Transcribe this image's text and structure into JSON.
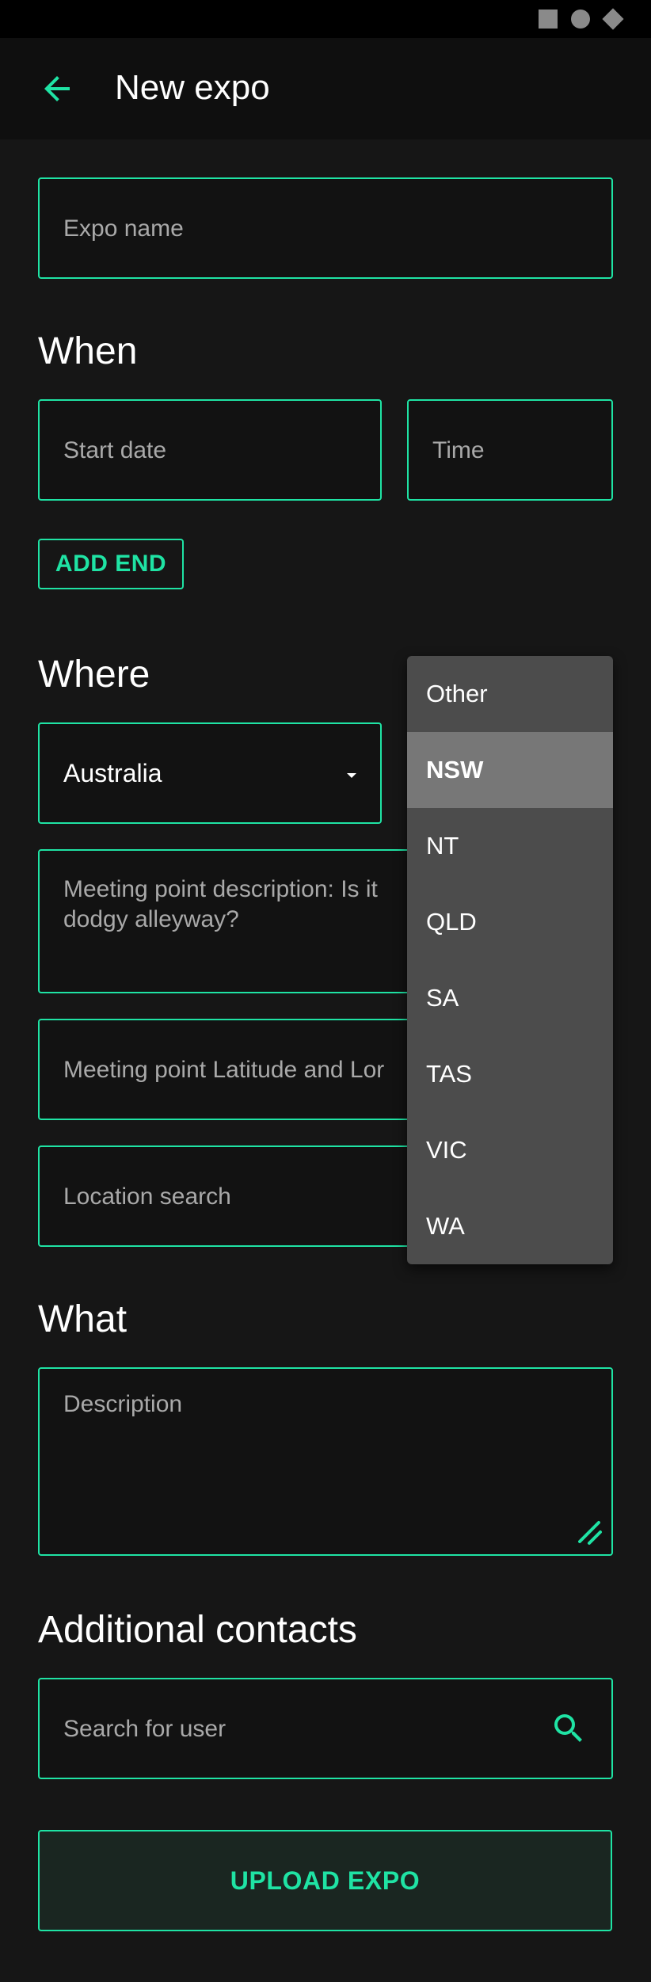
{
  "app": {
    "title": "New expo"
  },
  "form": {
    "expo_name_placeholder": "Expo name",
    "when_title": "When",
    "start_date_placeholder": "Start date",
    "time_placeholder": "Time",
    "add_end_label": "ADD END",
    "where_title": "Where",
    "country_value": "Australia",
    "meeting_point_description_placeholder_line1": "Meeting point description: Is it",
    "meeting_point_description_placeholder_line2": "dodgy alleyway?",
    "meeting_point_latlng_placeholder": "Meeting point Latitude and Lor",
    "location_search_placeholder": "Location search",
    "what_title": "What",
    "description_placeholder": "Description",
    "additional_contacts_title": "Additional contacts",
    "search_user_placeholder": "Search for user",
    "upload_label": "UPLOAD EXPO"
  },
  "state_menu": {
    "items": [
      "Other",
      "NSW",
      "NT",
      "QLD",
      "SA",
      "TAS",
      "VIC",
      "WA"
    ],
    "selected": "NSW"
  },
  "colors": {
    "accent": "#1fe3a4",
    "background": "#161616",
    "menu": "#4c4c4c",
    "menu_selected": "#777777"
  },
  "icons": {
    "back": "arrow-left-icon",
    "search": "search-icon",
    "resize": "resize-handle-icon",
    "dropdown": "caret-down-icon"
  }
}
